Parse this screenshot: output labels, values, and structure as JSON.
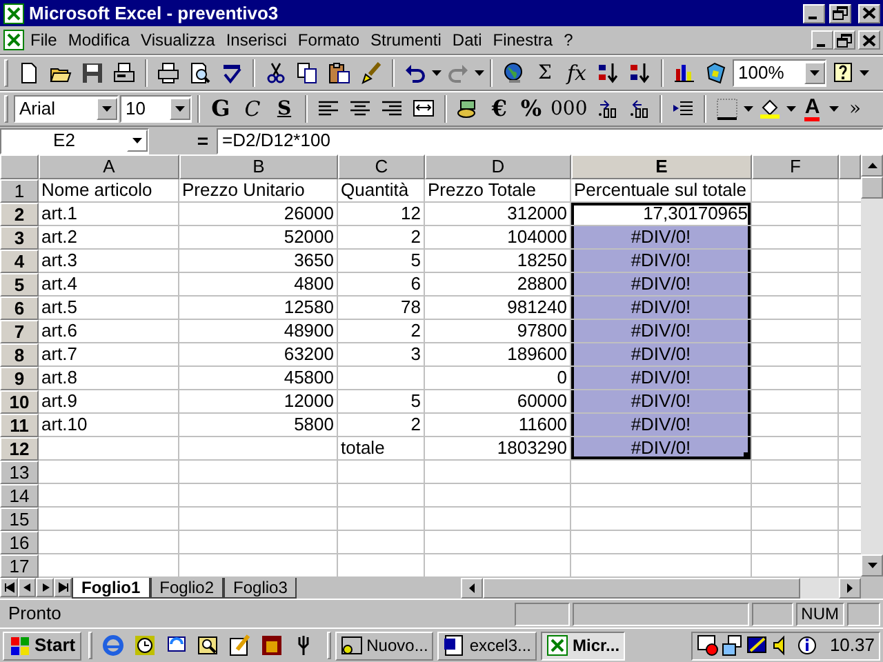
{
  "window": {
    "title": "Microsoft Excel - preventivo3"
  },
  "menu": [
    {
      "label": "File"
    },
    {
      "label": "Modifica"
    },
    {
      "label": "Visualizza"
    },
    {
      "label": "Inserisci"
    },
    {
      "label": "Formato"
    },
    {
      "label": "Strumenti"
    },
    {
      "label": "Dati"
    },
    {
      "label": "Finestra"
    },
    {
      "label": "?"
    }
  ],
  "toolbars": [
    [
      {
        "kind": "icon"
      },
      {
        "kind": "icon"
      },
      {
        "kind": "icon"
      },
      {
        "kind": "icon"
      },
      {
        "kind": "separator"
      },
      {
        "kind": "icon"
      },
      {
        "kind": "icon"
      },
      {
        "kind": "icon"
      },
      {
        "kind": "separator"
      },
      {
        "kind": "icon"
      },
      {
        "kind": "icon"
      },
      {
        "kind": "icon"
      },
      {
        "kind": "icon"
      },
      {
        "kind": "separator"
      },
      {
        "kind": "icon"
      },
      {
        "kind": "caret"
      },
      {
        "kind": "icon"
      },
      {
        "kind": "caret"
      },
      {
        "kind": "separator"
      },
      {
        "kind": "icon"
      },
      {
        "kind": "text",
        "label": "Σ"
      },
      {
        "kind": "italic",
        "label": "fx"
      },
      {
        "kind": "icon"
      },
      {
        "kind": "icon"
      },
      {
        "kind": "separator"
      },
      {
        "kind": "icon"
      },
      {
        "kind": "icon"
      },
      {
        "kind": "combo",
        "value": "100%"
      },
      {
        "kind": "icon"
      },
      {
        "kind": "caret"
      }
    ],
    [
      {
        "kind": "combo",
        "value": "Arial"
      },
      {
        "kind": "combo",
        "value": "10"
      },
      {
        "kind": "separator"
      },
      {
        "kind": "bold",
        "label": "G"
      },
      {
        "kind": "italic",
        "label": "C"
      },
      {
        "kind": "underline",
        "label": "S"
      },
      {
        "kind": "separator"
      },
      {
        "kind": "icon"
      },
      {
        "kind": "icon"
      },
      {
        "kind": "icon"
      },
      {
        "kind": "icon"
      },
      {
        "kind": "separator"
      },
      {
        "kind": "icon"
      },
      {
        "kind": "bold",
        "label": "€"
      },
      {
        "kind": "bold",
        "label": "%"
      },
      {
        "kind": "text",
        "label": "000"
      },
      {
        "kind": "icon"
      },
      {
        "kind": "icon"
      },
      {
        "kind": "separator"
      },
      {
        "kind": "icon"
      },
      {
        "kind": "separator"
      },
      {
        "kind": "icon"
      },
      {
        "kind": "caret"
      },
      {
        "kind": "icon"
      },
      {
        "kind": "caret"
      },
      {
        "kind": "color",
        "label": "A"
      },
      {
        "kind": "caret"
      },
      {
        "kind": "text",
        "label": "»"
      }
    ]
  ],
  "formula_bar": {
    "name_box": "E2",
    "equals": "=",
    "formula": "=D2/D12*100"
  },
  "columns": [
    {
      "label": "A",
      "selected": false
    },
    {
      "label": "B",
      "selected": false
    },
    {
      "label": "C",
      "selected": false
    },
    {
      "label": "D",
      "selected": false
    },
    {
      "label": "E",
      "selected": true
    },
    {
      "label": "F",
      "selected": false
    }
  ],
  "rows": [
    {
      "header": "1",
      "selected": false,
      "active": false,
      "cells": [
        {
          "text": "Nome articolo",
          "kind": "text"
        },
        {
          "text": "Prezzo Unitario",
          "kind": "text"
        },
        {
          "text": "Quantità",
          "kind": "text"
        },
        {
          "text": "Prezzo Totale",
          "kind": "text"
        },
        {
          "text": "Percentuale sul totale",
          "kind": "text"
        },
        null
      ]
    },
    {
      "header": "2",
      "selected": true,
      "active": true,
      "cells": [
        {
          "text": "art.1",
          "kind": "text"
        },
        {
          "text": "26000",
          "kind": "number"
        },
        {
          "text": "12",
          "kind": "number"
        },
        {
          "text": "312000",
          "kind": "number"
        },
        {
          "text": "17,30170965",
          "kind": "number"
        },
        null
      ]
    },
    {
      "header": "3",
      "selected": true,
      "active": false,
      "cells": [
        {
          "text": "art.2",
          "kind": "text"
        },
        {
          "text": "52000",
          "kind": "number"
        },
        {
          "text": "2",
          "kind": "number"
        },
        {
          "text": "104000",
          "kind": "number"
        },
        {
          "text": "#DIV/0!",
          "kind": "error"
        },
        null
      ]
    },
    {
      "header": "4",
      "selected": true,
      "active": false,
      "cells": [
        {
          "text": "art.3",
          "kind": "text"
        },
        {
          "text": "3650",
          "kind": "number"
        },
        {
          "text": "5",
          "kind": "number"
        },
        {
          "text": "18250",
          "kind": "number"
        },
        {
          "text": "#DIV/0!",
          "kind": "error"
        },
        null
      ]
    },
    {
      "header": "5",
      "selected": true,
      "active": false,
      "cells": [
        {
          "text": "art.4",
          "kind": "text"
        },
        {
          "text": "4800",
          "kind": "number"
        },
        {
          "text": "6",
          "kind": "number"
        },
        {
          "text": "28800",
          "kind": "number"
        },
        {
          "text": "#DIV/0!",
          "kind": "error"
        },
        null
      ]
    },
    {
      "header": "6",
      "selected": true,
      "active": false,
      "cells": [
        {
          "text": "art.5",
          "kind": "text"
        },
        {
          "text": "12580",
          "kind": "number"
        },
        {
          "text": "78",
          "kind": "number"
        },
        {
          "text": "981240",
          "kind": "number"
        },
        {
          "text": "#DIV/0!",
          "kind": "error"
        },
        null
      ]
    },
    {
      "header": "7",
      "selected": true,
      "active": false,
      "cells": [
        {
          "text": "art.6",
          "kind": "text"
        },
        {
          "text": "48900",
          "kind": "number"
        },
        {
          "text": "2",
          "kind": "number"
        },
        {
          "text": "97800",
          "kind": "number"
        },
        {
          "text": "#DIV/0!",
          "kind": "error"
        },
        null
      ]
    },
    {
      "header": "8",
      "selected": true,
      "active": false,
      "cells": [
        {
          "text": "art.7",
          "kind": "text"
        },
        {
          "text": "63200",
          "kind": "number"
        },
        {
          "text": "3",
          "kind": "number"
        },
        {
          "text": "189600",
          "kind": "number"
        },
        {
          "text": "#DIV/0!",
          "kind": "error"
        },
        null
      ]
    },
    {
      "header": "9",
      "selected": true,
      "active": false,
      "cells": [
        {
          "text": "art.8",
          "kind": "text"
        },
        {
          "text": "45800",
          "kind": "number"
        },
        null,
        {
          "text": "0",
          "kind": "number"
        },
        {
          "text": "#DIV/0!",
          "kind": "error"
        },
        null
      ]
    },
    {
      "header": "10",
      "selected": true,
      "active": false,
      "cells": [
        {
          "text": "art.9",
          "kind": "text"
        },
        {
          "text": "12000",
          "kind": "number"
        },
        {
          "text": "5",
          "kind": "number"
        },
        {
          "text": "60000",
          "kind": "number"
        },
        {
          "text": "#DIV/0!",
          "kind": "error"
        },
        null
      ]
    },
    {
      "header": "11",
      "selected": true,
      "active": false,
      "cells": [
        {
          "text": "art.10",
          "kind": "text"
        },
        {
          "text": "5800",
          "kind": "number"
        },
        {
          "text": "2",
          "kind": "number"
        },
        {
          "text": "11600",
          "kind": "number"
        },
        {
          "text": "#DIV/0!",
          "kind": "error"
        },
        null
      ]
    },
    {
      "header": "12",
      "selected": true,
      "active": false,
      "cells": [
        null,
        null,
        {
          "text": "totale",
          "kind": "text"
        },
        {
          "text": "1803290",
          "kind": "number"
        },
        {
          "text": "#DIV/0!",
          "kind": "error"
        },
        null
      ]
    },
    {
      "header": "13",
      "selected": false,
      "active": false
    },
    {
      "header": "14",
      "selected": false,
      "active": false
    },
    {
      "header": "15",
      "selected": false,
      "active": false
    },
    {
      "header": "16",
      "selected": false,
      "active": false
    },
    {
      "header": "17",
      "selected": false,
      "active": false
    }
  ],
  "sheet_tabs": [
    {
      "label": "Foglio1",
      "selected": true
    },
    {
      "label": "Foglio2",
      "selected": false
    },
    {
      "label": "Foglio3",
      "selected": false
    }
  ],
  "status_bar": {
    "text": "Pronto",
    "indicator": "NUM"
  },
  "taskbar": {
    "start": "Start",
    "tasks": [
      {
        "label": "Nuovo...",
        "selected": false
      },
      {
        "label": "excel3...",
        "selected": false
      },
      {
        "label": "Micr...",
        "selected": true
      }
    ],
    "clock": "10.37"
  }
}
